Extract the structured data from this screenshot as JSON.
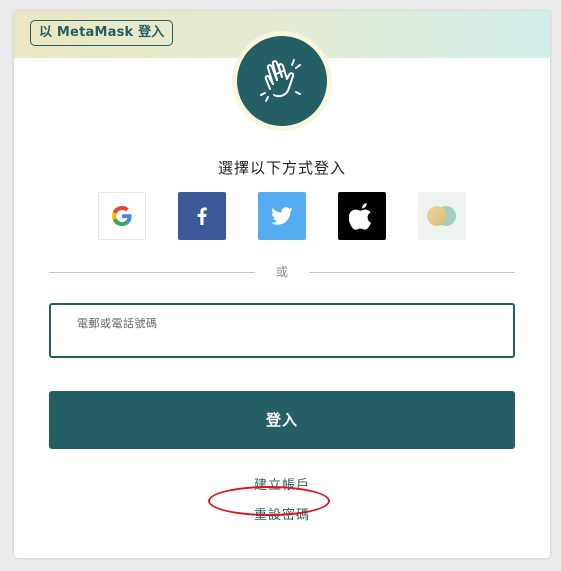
{
  "header": {
    "metamask_label": "以 MetaMask 登入"
  },
  "logo": {
    "icon": "clapping-hands-icon",
    "color": "#255f66"
  },
  "login": {
    "title": "選擇以下方式登入",
    "social_buttons": [
      {
        "name": "google",
        "icon": "google-icon"
      },
      {
        "name": "facebook",
        "icon": "facebook-icon",
        "color": "#3b5998"
      },
      {
        "name": "twitter",
        "icon": "twitter-icon",
        "color": "#55acee"
      },
      {
        "name": "apple",
        "icon": "apple-icon",
        "color": "#000000"
      },
      {
        "name": "other",
        "icon": "two-circles-icon"
      }
    ],
    "divider_text": "或",
    "input_label": "電郵或電話號碼",
    "input_value": "",
    "submit_label": "登入",
    "create_account": "建立帳戶",
    "reset_password": "重設密碼"
  },
  "colors": {
    "accent": "#255f66",
    "annotation": "#e2141c"
  }
}
